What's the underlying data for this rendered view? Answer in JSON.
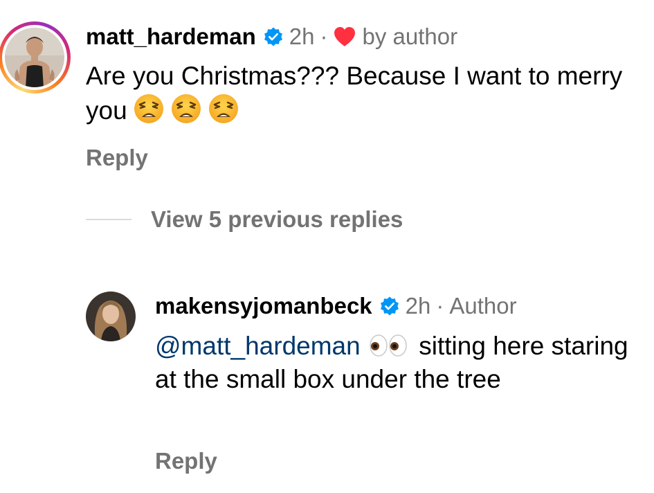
{
  "comment": {
    "username": "matt_hardeman",
    "time": "2h",
    "separator": "·",
    "liked_by": "by author",
    "text": "Are you Christmas??? Because I want to merry you",
    "emoji_count": 3,
    "reply_label": "Reply"
  },
  "thread": {
    "view_replies_label": "View 5 previous replies"
  },
  "reply": {
    "username": "makensyjomanbeck",
    "time": "2h",
    "separator": "·",
    "author_label": "Author",
    "mention": "@matt_hardeman",
    "text": "sitting here staring at the small box under the tree",
    "reply_label": "Reply"
  },
  "colors": {
    "verified": "#0095f6",
    "heart": "#ff3040",
    "muted_text": "#737373",
    "mention": "#00376b"
  },
  "icons": {
    "verified": "verified-badge-icon",
    "heart": "heart-icon",
    "emoji_weary": "weary-face-emoji",
    "emoji_eyes": "eyes-emoji"
  }
}
